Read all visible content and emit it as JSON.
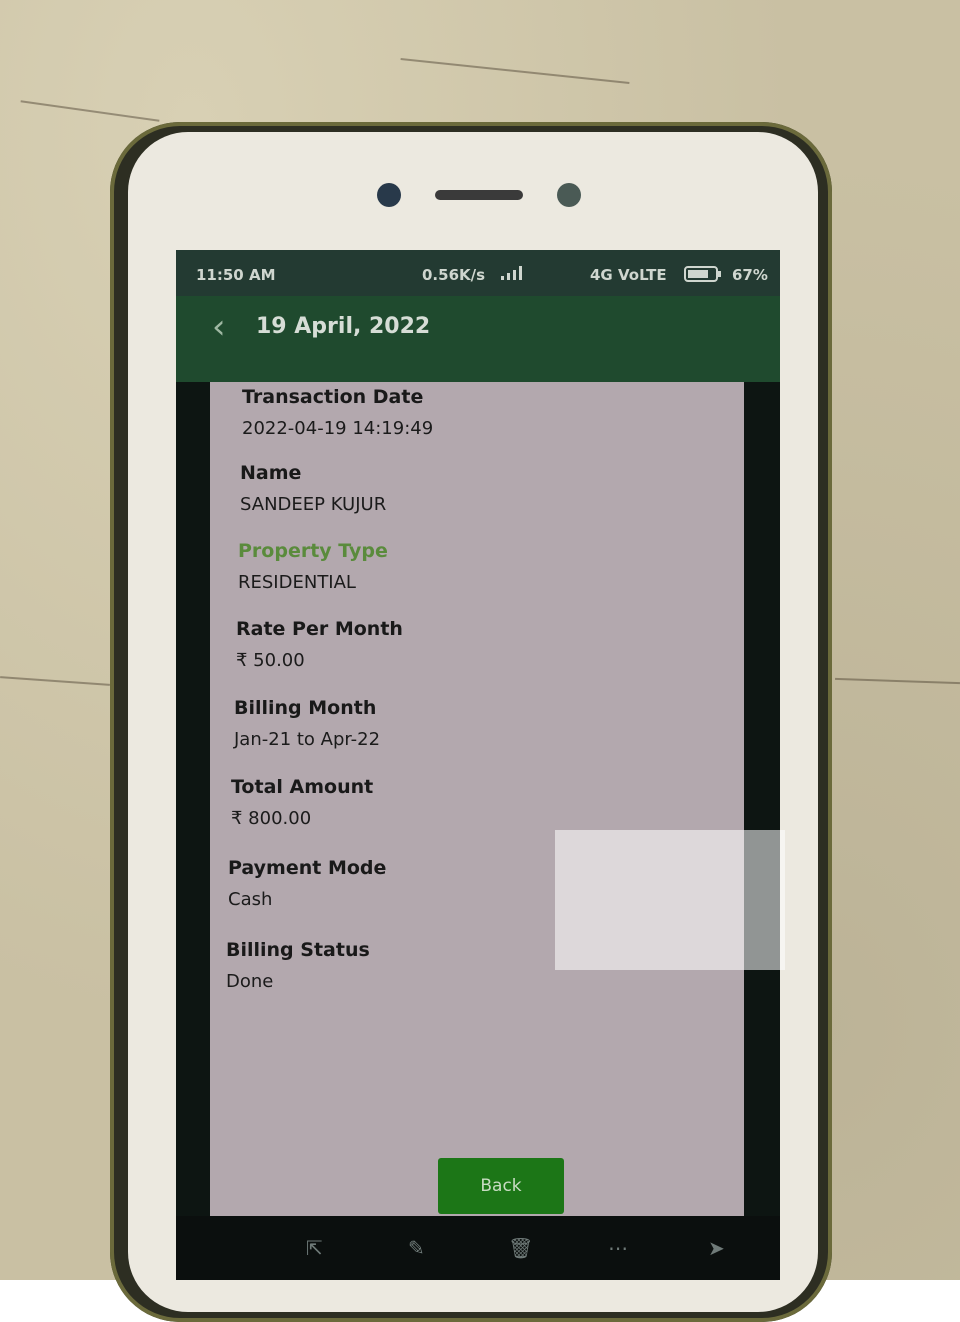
{
  "status_bar": {
    "time": "11:50 AM",
    "speed": "0.56K/s",
    "network": "4G VoLTE",
    "battery": "67%"
  },
  "header": {
    "date": "19 April, 2022"
  },
  "details": {
    "transaction_date": {
      "label": "Transaction Date",
      "value": "2022-04-19 14:19:49"
    },
    "name": {
      "label": "Name",
      "value": "SANDEEP KUJUR"
    },
    "property_type": {
      "label": "Property Type",
      "value": "RESIDENTIAL"
    },
    "rate_per_month": {
      "label": "Rate Per Month",
      "value": "₹ 50.00"
    },
    "billing_month": {
      "label": "Billing Month",
      "value": "Jan-21 to Apr-22"
    },
    "total_amount": {
      "label": "Total Amount",
      "value": "₹ 800.00"
    },
    "payment_mode": {
      "label": "Payment Mode",
      "value": "Cash"
    },
    "billing_status": {
      "label": "Billing Status",
      "value": "Done"
    }
  },
  "buttons": {
    "back_label": "Back"
  },
  "colors": {
    "accent_label": "#5d8f3e",
    "button_bg": "#1d7a18",
    "header_bg": "#1f4a2e"
  },
  "icons": {
    "header_back": "chevron-left-icon",
    "nav": [
      "share-icon",
      "edit-icon",
      "delete-icon",
      "more-icon",
      "send-icon"
    ]
  }
}
